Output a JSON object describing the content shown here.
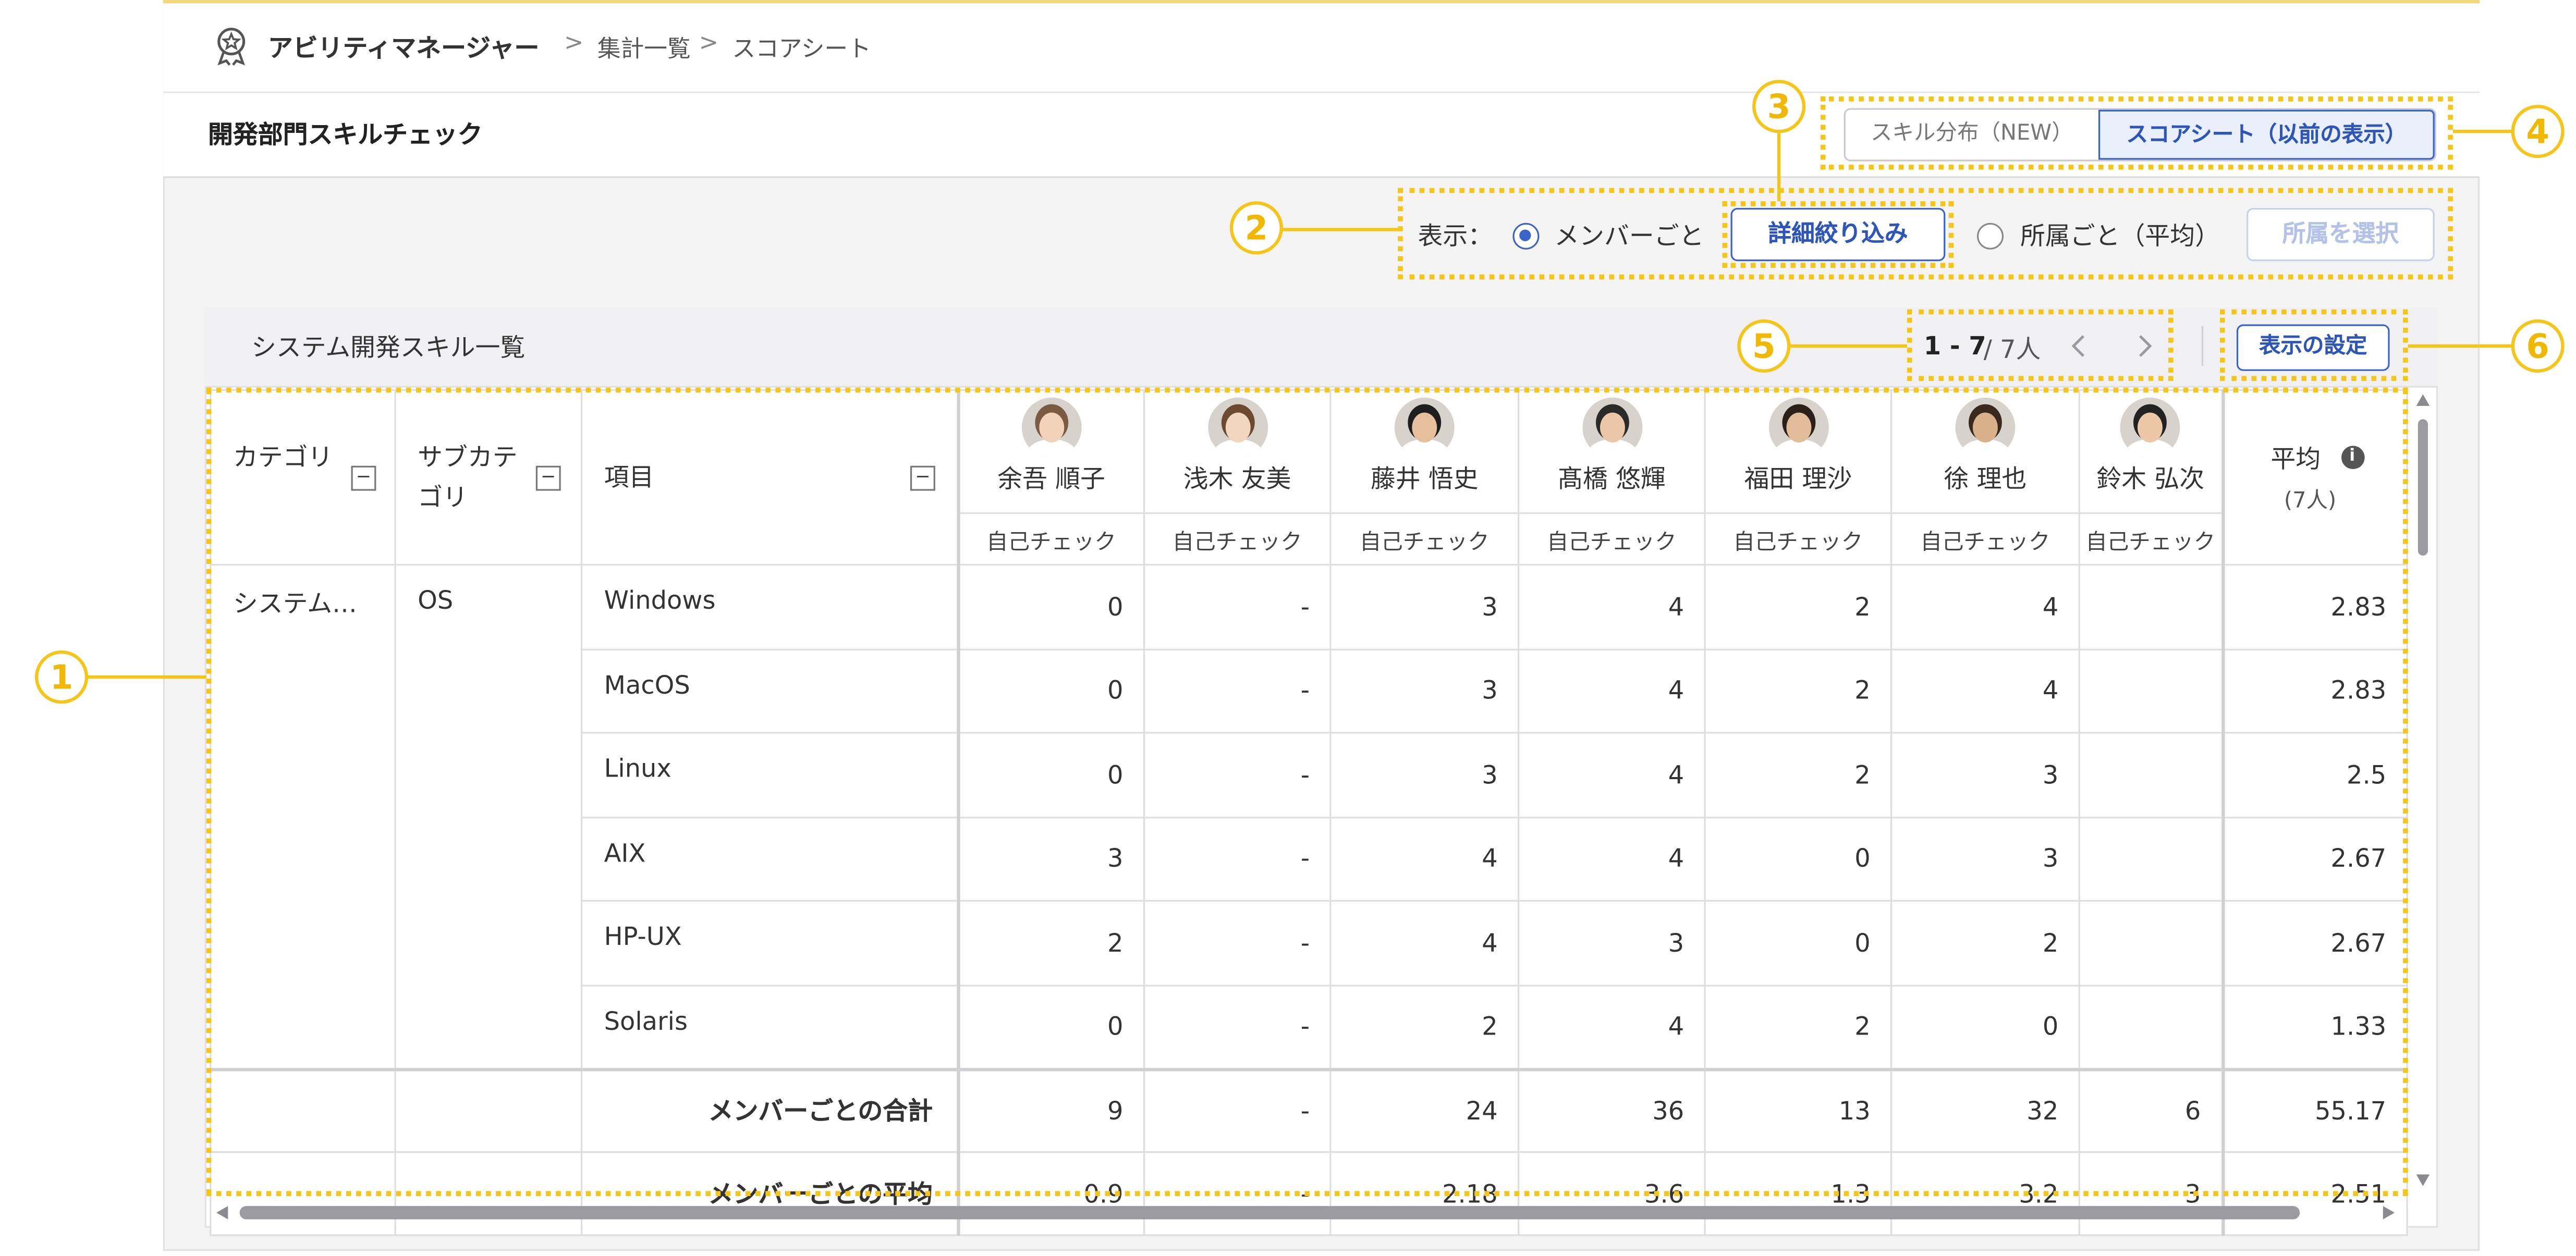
{
  "breadcrumb": {
    "app": "アビリティマネージャー",
    "sep": ">",
    "level2": "集計一覧",
    "level3": "スコアシート"
  },
  "page_title": "開発部門スキルチェック",
  "view_tabs": {
    "skill_dist": "スキル分布（NEW）",
    "scoresheet": "スコアシート（以前の表示）"
  },
  "display": {
    "label": "表示：",
    "by_member": "メンバーごと",
    "detail_filter": "詳細絞り込み",
    "by_dept": "所属ごと（平均）",
    "select_dept": "所属を選択"
  },
  "card": {
    "title": "システム開発スキル一覧",
    "page_range": "1 - 7",
    "page_total": "/ 7人",
    "settings": "表示の設定"
  },
  "table": {
    "col_category": "カテゴリ",
    "col_subcategory": "サブカテゴリ",
    "col_item": "項目",
    "col_avg": "平均",
    "col_avg_sub": "(7人)",
    "self_check": "自己チェック",
    "members": [
      {
        "name": "余吾 順子",
        "hair": "#7a5a40",
        "skin": "#f2d2b8"
      },
      {
        "name": "浅木 友美",
        "hair": "#6b4a30",
        "skin": "#f3d6c0"
      },
      {
        "name": "藤井 悟史",
        "hair": "#1e1e1e",
        "skin": "#e6c09c"
      },
      {
        "name": "髙橋 悠輝",
        "hair": "#2a2a2a",
        "skin": "#e9c7a8"
      },
      {
        "name": "福田 理沙",
        "hair": "#2b1f18",
        "skin": "#e2bb98"
      },
      {
        "name": "徐 理也",
        "hair": "#3a2a1e",
        "skin": "#d9b08a"
      },
      {
        "name": "鈴木 弘次",
        "hair": "#222222",
        "skin": "#ecc8a6"
      }
    ],
    "category_value": "システム…",
    "subcategory_value": "OS",
    "rows": [
      {
        "item": "Windows",
        "values": [
          "0",
          "-",
          "3",
          "4",
          "2",
          "4",
          ""
        ],
        "avg": "2.83"
      },
      {
        "item": "MacOS",
        "values": [
          "0",
          "-",
          "3",
          "4",
          "2",
          "4",
          ""
        ],
        "avg": "2.83"
      },
      {
        "item": "Linux",
        "values": [
          "0",
          "-",
          "3",
          "4",
          "2",
          "3",
          ""
        ],
        "avg": "2.5"
      },
      {
        "item": "AIX",
        "values": [
          "3",
          "-",
          "4",
          "4",
          "0",
          "3",
          ""
        ],
        "avg": "2.67"
      },
      {
        "item": "HP-UX",
        "values": [
          "2",
          "-",
          "4",
          "3",
          "0",
          "2",
          ""
        ],
        "avg": "2.67"
      },
      {
        "item": "Solaris",
        "values": [
          "0",
          "-",
          "2",
          "4",
          "2",
          "0",
          ""
        ],
        "avg": "1.33"
      }
    ],
    "total": {
      "label": "メンバーごとの合計",
      "values": [
        "9",
        "-",
        "24",
        "36",
        "13",
        "32",
        "6"
      ],
      "avg": "55.17"
    },
    "average": {
      "label": "メンバーごとの平均",
      "values": [
        "0.9",
        "-",
        "2.18",
        "3.6",
        "1.3",
        "3.2",
        "3"
      ],
      "avg": "2.51"
    }
  },
  "annotations": [
    "1",
    "2",
    "3",
    "4",
    "5",
    "6"
  ],
  "colors": {
    "accent": "#3b64c8",
    "annotation": "#f5c518"
  }
}
